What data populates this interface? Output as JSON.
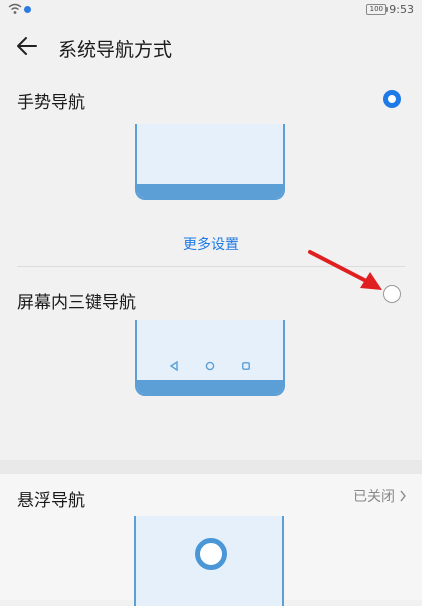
{
  "status_bar": {
    "time": "9:53",
    "battery": "100"
  },
  "header": {
    "title": "系统导航方式",
    "back_icon": "arrow-left-icon"
  },
  "options": [
    {
      "label": "手势导航",
      "selected": true
    },
    {
      "label": "屏幕内三键导航",
      "selected": false
    }
  ],
  "more_settings": "更多设置",
  "floating_nav": {
    "label": "悬浮导航",
    "status": "已关闭"
  },
  "colors": {
    "accent": "#1e7ae5",
    "illustration": "#5b9fd6",
    "annotation_arrow": "#e02020"
  }
}
